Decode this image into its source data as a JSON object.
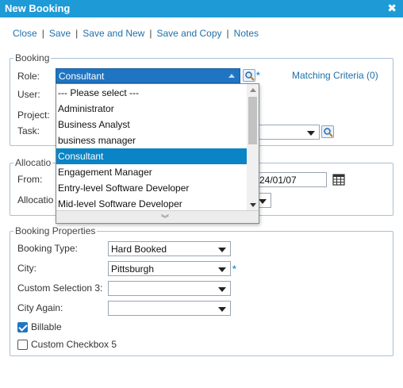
{
  "window": {
    "title": "New Booking",
    "close_glyph": "✖"
  },
  "toolbar": {
    "close": "Close",
    "save": "Save",
    "save_and_new": "Save and New",
    "save_and_copy": "Save and Copy",
    "notes": "Notes",
    "separator": "|"
  },
  "booking": {
    "legend": "Booking",
    "role_label": "Role:",
    "role_value": "Consultant",
    "user_label": "User:",
    "project_label": "Project:",
    "task_label": "Task:",
    "required_mark": "*",
    "matching_criteria": "Matching Criteria (0)"
  },
  "role_dropdown": {
    "options": [
      "--- Please select ---",
      "Administrator",
      "Business Analyst",
      "business manager",
      "Consultant",
      "Engagement Manager",
      "Entry-level Software Developer",
      "Mid-level Software Developer"
    ],
    "selected_index": 4,
    "more_glyph": "︾"
  },
  "allocation": {
    "legend": "Allocatio",
    "from_label": "From:",
    "from_date_partial": "24/01/07",
    "allocation_label": "Allocatio"
  },
  "booking_properties": {
    "legend": "Booking Properties",
    "booking_type_label": "Booking Type:",
    "booking_type_value": "Hard Booked",
    "city_label": "City:",
    "city_value": "Pittsburgh",
    "custom_selection_label": "Custom Selection 3:",
    "custom_selection_value": "",
    "city_again_label": "City Again:",
    "city_again_value": "",
    "billable_label": "Billable",
    "billable_checked": true,
    "custom_checkbox_label": "Custom Checkbox 5",
    "custom_checkbox_checked": false,
    "required_mark": "*"
  },
  "colors": {
    "titlebar": "#1e9ad6",
    "link": "#1f6fa8",
    "selected_option": "#0a84c4",
    "role_select": "#1f75c2"
  },
  "icons": {
    "close": "close-icon",
    "search": "magnifier-icon",
    "calendar": "calendar-icon",
    "dropdown": "chevron-down-icon"
  }
}
